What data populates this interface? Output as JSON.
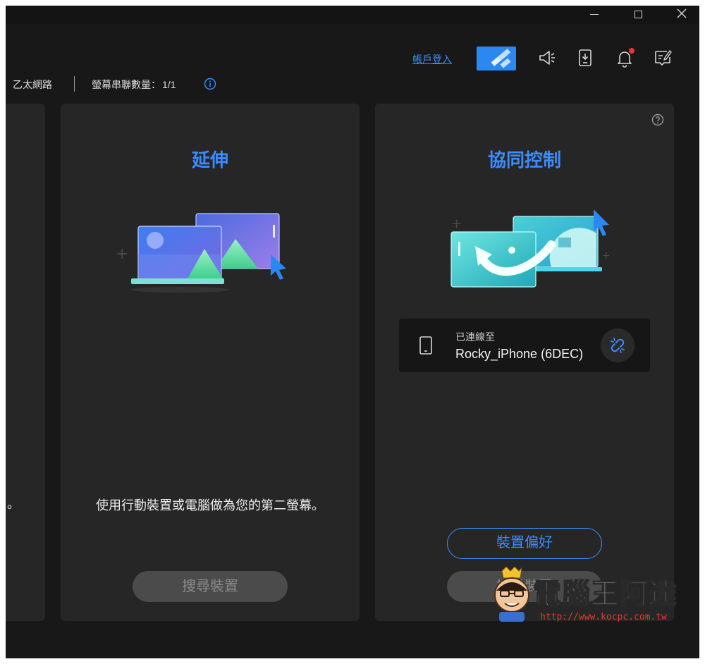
{
  "topbar": {
    "login_link": "帳戶登入",
    "icons": [
      "promo-badge",
      "megaphone-icon",
      "download-icon",
      "bell-icon",
      "feedback-icon"
    ]
  },
  "status": {
    "network": "乙太網路",
    "screen_count_label": "螢幕串聯數量：",
    "screen_count_value": "1/1"
  },
  "cards": {
    "left": {
      "tail_text": "。"
    },
    "extend": {
      "title": "延伸",
      "description": "使用行動裝置或電腦做為您的第二螢幕。",
      "search_button": "搜尋裝置"
    },
    "collab": {
      "title": "協同控制",
      "connected_label": "已連線至",
      "device_name": "Rocky_iPhone (6DEC)",
      "prefs_button": "裝置偏好",
      "hidden_button": "搜尋裝置"
    }
  },
  "watermark": {
    "text": "電腦王阿達",
    "url": "http://www.kocpc.com.tw"
  },
  "colors": {
    "accent": "#3c8cff",
    "background": "#181818",
    "card": "#262626",
    "notification": "#e53935"
  }
}
